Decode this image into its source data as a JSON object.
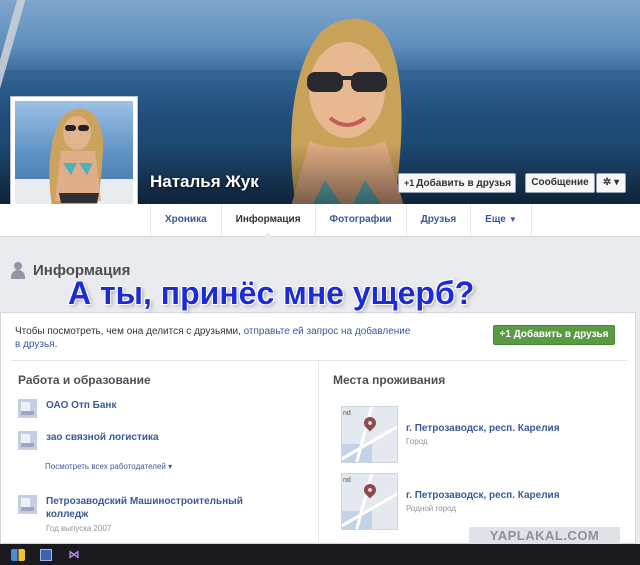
{
  "profile": {
    "name": "Наталья Жук",
    "add_friend_label": "Добавить в друзья",
    "message_label": "Сообщение",
    "settings_label": "✲ ▾"
  },
  "tabs": [
    {
      "label": "Хроника"
    },
    {
      "label": "Информация"
    },
    {
      "label": "Фотографии"
    },
    {
      "label": "Друзья"
    },
    {
      "label": "Еще"
    }
  ],
  "section": {
    "title": "Информация",
    "caption": "А ты, принёс мне ущерб?"
  },
  "notice": {
    "text": "Чтобы посмотреть, чем она делится с друзьями, ",
    "link": "отправьте ей запрос на добавление в друзья",
    "end": ".",
    "button_label": "Добавить в друзья"
  },
  "work": {
    "title": "Работа и образование",
    "items": [
      {
        "name": "ОАО Отп Банк",
        "sub": ""
      },
      {
        "name": "зао связной логистика",
        "sub": ""
      },
      {
        "name": "Петрозаводский Машиностроительный колледж",
        "sub": "Год выпуска 2007"
      }
    ],
    "see_all": "Посмотреть всех работодателей"
  },
  "places": {
    "title": "Места проживания",
    "items": [
      {
        "name": "г. Петрозаводск, респ. Карелия",
        "sub": "Город"
      },
      {
        "name": "г. Петрозаводск, респ. Карелия",
        "sub": "Родной город"
      }
    ]
  },
  "watermark": "YAPLAKAL.COM"
}
